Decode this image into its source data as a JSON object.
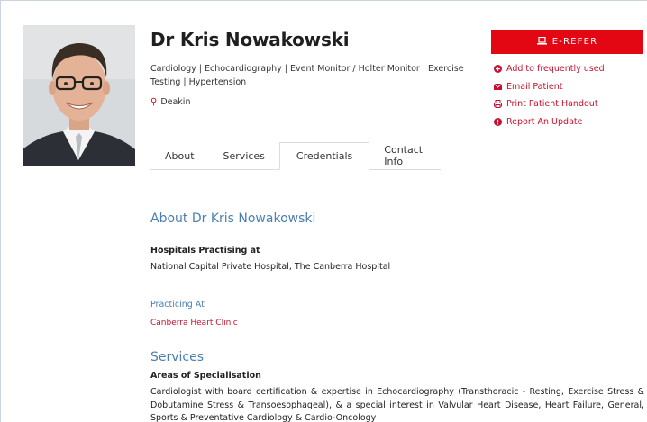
{
  "doctor": {
    "name": "Dr Kris Nowakowski",
    "specialties": "Cardiology | Echocardiography | Event Monitor / Holter Monitor | Exercise Testing | Hypertension",
    "location": "Deakin"
  },
  "actions": {
    "erefer_label": "E-REFER",
    "items": [
      {
        "label": "Add to frequently used",
        "icon": "plus-circle-icon"
      },
      {
        "label": "Email Patient",
        "icon": "envelope-icon"
      },
      {
        "label": "Print Patient Handout",
        "icon": "printer-icon"
      },
      {
        "label": "Report An Update",
        "icon": "exclamation-circle-icon"
      }
    ]
  },
  "tabs": [
    {
      "label": "About",
      "active": false
    },
    {
      "label": "Services",
      "active": false
    },
    {
      "label": "Credentials",
      "active": true
    },
    {
      "label": "Contact Info",
      "active": false
    }
  ],
  "about": {
    "title": "About Dr Kris Nowakowski",
    "hospitals_label": "Hospitals Practising at",
    "hospitals_value": "National Capital Private Hospital, The Canberra Hospital",
    "practicing_label": "Practicing At",
    "practicing_value": "Canberra Heart Clinic"
  },
  "services": {
    "title": "Services",
    "areas_label": "Areas of Specialisation",
    "areas_text": "Cardiologist with board certification & expertise in Echocardiography (Transthoracic - Resting, Exercise Stress & Dobutamine Stress & Transoesophageal), & a special interest in Valvular Heart Disease, Heart Failure, General, Sports & Preventative Cardiology & Cardio-Oncology"
  },
  "colors": {
    "accent_red": "#e30613",
    "link_red": "#c8102e",
    "heading_blue": "#4a7fb0"
  }
}
